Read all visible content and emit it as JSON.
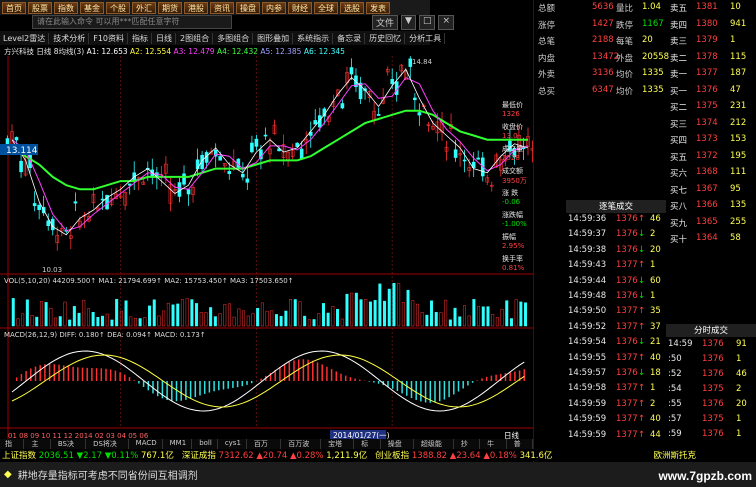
{
  "toolbar": [
    "首页",
    "股票",
    "指数",
    "基金",
    "个股",
    "外汇",
    "期货",
    "港股",
    "资讯",
    "操盘",
    "内参",
    "财经",
    "全球",
    "选股",
    "发表"
  ],
  "search_placeholder": "请在此输入命令    可以用***匹配任意字符",
  "window_menu": [
    "文件",
    "▼",
    "□",
    "×"
  ],
  "toolbar2": [
    "Level2雷达",
    "技术分析",
    "F10资料",
    "指标",
    "日线",
    "2图组合",
    "多图组合",
    "图形叠加",
    "系统指示",
    "备忘录",
    "历史回忆",
    "分析工具"
  ],
  "ma_legend": {
    "stock": "方兴科技 日线",
    "ma": "8均线(3)",
    "a1": "A1: 12.653",
    "a2": "A2: 12.554",
    "a3": "A3: 12.479",
    "a4": "A4: 12.432",
    "a5": "A5: 12.385",
    "a6": "A6: 12.345"
  },
  "price_label": "13.114",
  "low_label": "10.03",
  "high_label": "14.84",
  "vol_legend": "VOL(5,10,20)  44209.500↑  MA1: 21794.699↑  MA2: 15753.450↑  MA3: 17503.650↑",
  "macd_legend": "MACD(26,12,9)  DIFF: 0.180↑  DEA: 0.094↑  MACD: 0.173↑",
  "date_label": "2014/01/27(一)",
  "x_axis_left": "01 08 09 10 11 12 2014 02 03 04 05 06",
  "right_axis_label": "日线",
  "side_labels": [
    "总额",
    "涨停",
    "总笔",
    "内盘",
    "外卖"
  ],
  "quote_rows": [
    {
      "l1": "总额",
      "v1": "5636",
      "l2": "量比",
      "v2": "1.04",
      "l3": "卖五",
      "p": "1381",
      "q": "10"
    },
    {
      "l1": "涨停",
      "v1": "1427",
      "l2": "跌停",
      "v2": "1167",
      "l3": "卖四",
      "p": "1380",
      "q": "941"
    },
    {
      "l1": "总笔",
      "v1": "2188",
      "l2": "每笔",
      "v2": "20",
      "l3": "卖三",
      "p": "1379",
      "q": "1"
    },
    {
      "l1": "内盘",
      "v1": "13472",
      "l2": "外盘",
      "v2": "20558",
      "l3": "卖二",
      "p": "1378",
      "q": "115"
    },
    {
      "l1": "外卖",
      "v1": "3136",
      "l2": "均价",
      "v2": "1335",
      "l3": "卖一",
      "p": "1377",
      "q": "187"
    },
    {
      "l1": "总买",
      "v1": "6347",
      "l2": "均价",
      "v2": "1335",
      "l3": "买一",
      "p": "1376",
      "q": "47"
    }
  ],
  "buy_rows": [
    {
      "l": "买二",
      "p": "1375",
      "q": "231"
    },
    {
      "l": "买三",
      "p": "1374",
      "q": "212"
    },
    {
      "l": "买四",
      "p": "1373",
      "q": "153"
    },
    {
      "l": "买五",
      "p": "1372",
      "q": "195"
    },
    {
      "l": "买六",
      "p": "1368",
      "q": "111"
    },
    {
      "l": "买七",
      "p": "1367",
      "q": "95"
    },
    {
      "l": "买八",
      "p": "1366",
      "q": "135"
    },
    {
      "l": "买九",
      "p": "1365",
      "q": "255"
    },
    {
      "l": "买十",
      "p": "1364",
      "q": "58"
    }
  ],
  "mini_labels": [
    "最低价",
    "收盘价",
    "成交量",
    "成交额",
    "涨 跌",
    "涨跌幅",
    "振幅",
    "换手率"
  ],
  "mini_values": [
    "1326",
    "13.0",
    "2528",
    "3950万",
    "-0.06",
    "-1.00%",
    "2.95%",
    "0.81%"
  ],
  "trade_title": "逐笔成交",
  "trades": [
    {
      "t": "14:59:36",
      "p": "1376",
      "a": "↑",
      "q": "46"
    },
    {
      "t": "14:59:37",
      "p": "1376",
      "a": "↓",
      "q": "2"
    },
    {
      "t": "14:59:38",
      "p": "1376",
      "a": "↓",
      "q": "20"
    },
    {
      "t": "14:59:43",
      "p": "1377",
      "a": "↑",
      "q": "1"
    },
    {
      "t": "14:59:44",
      "p": "1376",
      "a": "↓",
      "q": "60"
    },
    {
      "t": "14:59:48",
      "p": "1376",
      "a": "↓",
      "q": "1"
    },
    {
      "t": "14:59:50",
      "p": "1377",
      "a": "↑",
      "q": "35"
    },
    {
      "t": "14:59:52",
      "p": "1377",
      "a": "↑",
      "q": "37"
    },
    {
      "t": "14:59:54",
      "p": "1376",
      "a": "↓",
      "q": "21"
    },
    {
      "t": "14:59:55",
      "p": "1377",
      "a": "↑",
      "q": "40"
    },
    {
      "t": "14:59:57",
      "p": "1376",
      "a": "↓",
      "q": "18"
    },
    {
      "t": "14:59:58",
      "p": "1377",
      "a": "↑",
      "q": "1"
    },
    {
      "t": "14:59:59",
      "p": "1377",
      "a": "↑",
      "q": "2"
    },
    {
      "t": "14:59:59",
      "p": "1377",
      "a": "↑",
      "q": "40"
    },
    {
      "t": "14:59:59",
      "p": "1377",
      "a": "↑",
      "q": "44"
    }
  ],
  "sub_trade_title": "分时成交",
  "sub_trades": [
    {
      "t": "14:59",
      "p": "1376",
      "q": "91"
    },
    {
      "t": ":50",
      "p": "1376",
      "q": "1"
    },
    {
      "t": ":52",
      "p": "1376",
      "q": "46"
    },
    {
      "t": ":54",
      "p": "1375",
      "q": "2"
    },
    {
      "t": ":55",
      "p": "1376",
      "q": "20"
    },
    {
      "t": ":57",
      "p": "1375",
      "q": "1"
    },
    {
      "t": ":59",
      "p": "1376",
      "q": "1"
    }
  ],
  "bottom_tabs": [
    "指标",
    "主图",
    "BS决策",
    "DS将决策",
    "MACD",
    "MM1",
    "boll",
    "cys1",
    "百万cd",
    "百万波段",
    "宝塔线",
    "标准",
    "操盘手",
    "超级能量",
    "抄底",
    "牛刀",
    "普通"
  ],
  "index_bar": [
    {
      "name": "上证指数",
      "val": "2036.51",
      "chg": "▼2.17",
      "pct": "▼0.11%",
      "amt": "767.1亿"
    },
    {
      "name": "深证成指",
      "val": "7312.62",
      "chg": "▲20.74",
      "pct": "▲0.28%",
      "amt": "1,211.9亿"
    },
    {
      "name": "创业板指",
      "val": "1388.82",
      "chg": "▲23.64",
      "pct": "▲0.18%",
      "amt": "341.6亿"
    }
  ],
  "index_right": "欧洲斯托克",
  "news": "耕地存量指标可考虑不同省份间互相调剂",
  "watermark": "www.7gpzb.com",
  "chart_data": {
    "type": "candlestick",
    "ylim": [
      10.0,
      15.0
    ],
    "price_points": [
      13.1,
      12.6,
      11.6,
      11.0,
      10.8,
      11.2,
      11.4,
      11.7,
      11.9,
      12.2,
      12.4,
      12.1,
      11.8,
      12.0,
      12.6,
      12.9,
      12.5,
      12.3,
      12.8,
      13.1,
      12.8,
      12.9,
      13.3,
      13.7,
      14.2,
      14.6,
      14.3,
      13.9,
      14.4,
      14.8,
      14.1,
      13.5,
      13.2,
      12.9,
      12.4,
      12.3,
      12.7,
      13.0,
      12.9
    ],
    "ma_long": [
      12.9,
      12.7,
      12.5,
      12.2,
      12.0,
      11.9,
      11.9,
      12.0,
      12.1,
      12.1,
      12.2,
      12.2,
      12.2,
      12.2,
      12.3,
      12.4,
      12.4,
      12.4,
      12.5,
      12.6,
      12.6,
      12.6,
      12.7,
      12.9,
      13.1,
      13.3,
      13.5,
      13.6,
      13.7,
      13.8,
      13.8,
      13.7,
      13.5,
      13.3,
      13.2,
      13.1,
      13.1,
      13.1,
      13.1
    ]
  }
}
